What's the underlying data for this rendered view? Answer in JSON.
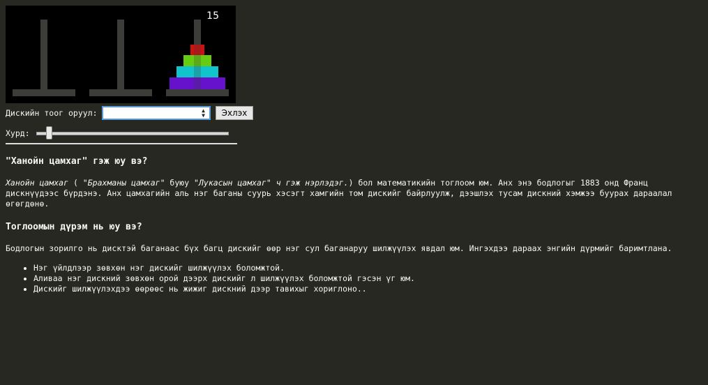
{
  "game": {
    "move_count": "15",
    "disks": [
      {
        "size": 1,
        "color": "#cc1111",
        "peg": 3
      },
      {
        "size": 2,
        "color": "#66cc11",
        "peg": 3
      },
      {
        "size": 3,
        "color": "#11c4cc",
        "peg": 3
      },
      {
        "size": 4,
        "color": "#6611cc",
        "peg": 3
      }
    ]
  },
  "controls": {
    "disk_count_label": "Дискийн тоог оруул:",
    "disk_count_value": "",
    "start_label": "Эхлэх",
    "speed_label": "Хурд:",
    "speed_value": 0.07
  },
  "article": {
    "h1": "\"Ханойн цамхаг\" гэж юу вэ?",
    "intro_em1": "Ханойн цамхаг",
    "intro_t1": " ( ",
    "intro_em2": "\"Брахманы цамхаг\"",
    "intro_t2": " буюу ",
    "intro_em3": "\"Лукасын цамхаг\" ч гэж нэрлэдэг.",
    "intro_t3": ") бол математикийн тоглоом юм. Анх энэ бодлогыг 1883 онд Франц",
    "intro_line2": "дискнүүдээс бүрдэнэ. Анх цамхагийн аль нэг баганы суурь хэсэгт хамгийн том дискийг байрлуулж, дээшлэх тусам дискний хэмжээ буурах дараалал",
    "intro_line3": "өгөгдөнө.",
    "h2": "Тоглоомын дүрэм нь юу вэ?",
    "goal": "Бодлогын зорилго нь дисктэй баганаас бүх багц дискийг өөр нэг сул баганаруу шилжүүлэх явдал юм. Ингэхдээ дараах энгийн дүрмийг баримтлана.",
    "rules": [
      "Нэг үйлдлээр зөвхөн нэг дискийг шилжүүлэх боломжтой.",
      "Аливаа нэг дискний зөвхөн орой дээрх дискийг л шилжүүлэх боломжтой гэсэн үг юм.",
      "Дискийг шилжүүлэхдээ өөрөөс нь жижиг дискний дээр тавихыг хориглоно.."
    ]
  }
}
